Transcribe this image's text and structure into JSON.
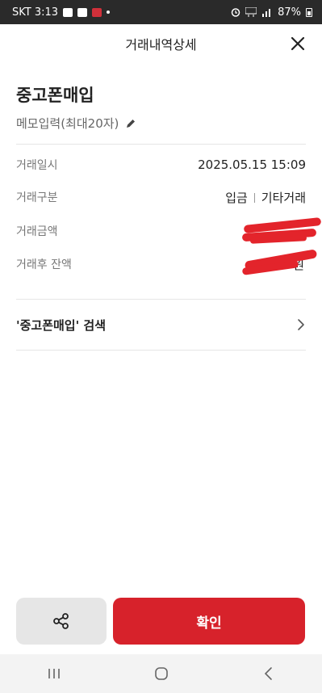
{
  "statusbar": {
    "carrier_time": "SKT 3:13",
    "battery": "87%"
  },
  "header": {
    "title": "거래내역상세"
  },
  "transaction": {
    "title": "중고폰매입",
    "memo_placeholder": "메모입력(최대20자)"
  },
  "details": {
    "date_label": "거래일시",
    "date_value": "2025.05.15 15:09",
    "type_label": "거래구분",
    "type_value_1": "입금",
    "type_value_2": "기타거래",
    "amount_label": "거래금액",
    "balance_label": "거래후 잔액",
    "balance_tail": "원"
  },
  "search": {
    "label": "'중고폰매입' 검색"
  },
  "buttons": {
    "confirm": "확인"
  },
  "colors": {
    "accent": "#d7222b",
    "redaction": "#e3242b"
  }
}
